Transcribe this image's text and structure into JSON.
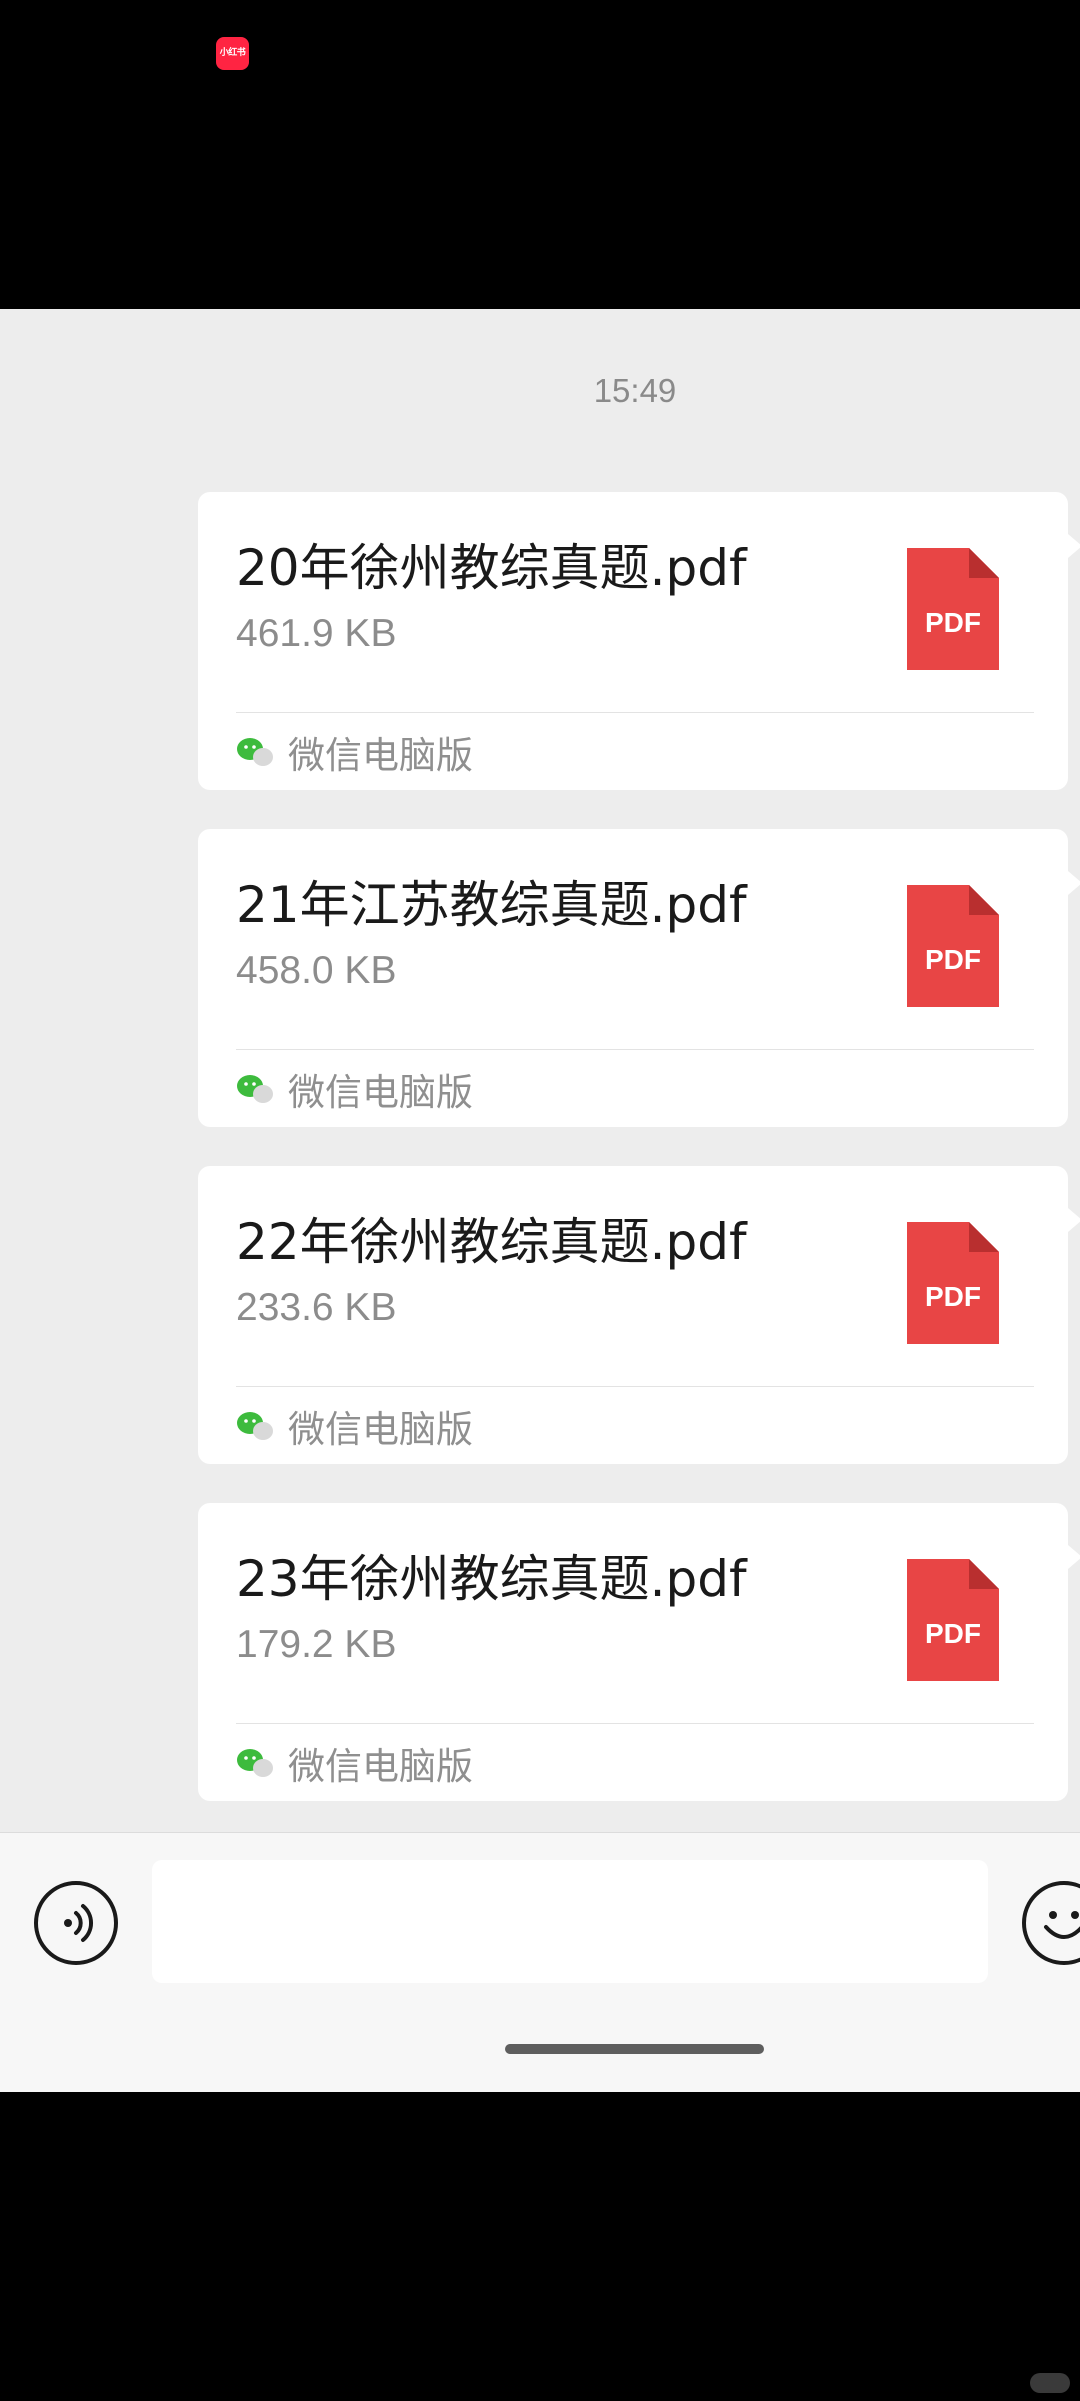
{
  "watermark": {
    "badge_text": "小红书"
  },
  "chat": {
    "timestamp": "15:49",
    "messages": [
      {
        "file_name": "20年徐州教综真题.pdf",
        "file_size": "461.9  KB",
        "file_type_label": "PDF",
        "source": "微信电脑版"
      },
      {
        "file_name": "21年江苏教综真题.pdf",
        "file_size": "458.0  KB",
        "file_type_label": "PDF",
        "source": "微信电脑版"
      },
      {
        "file_name": "22年徐州教综真题.pdf",
        "file_size": "233.6  KB",
        "file_type_label": "PDF",
        "source": "微信电脑版"
      },
      {
        "file_name": "23年徐州教综真题.pdf",
        "file_size": "179.2  KB",
        "file_type_label": "PDF",
        "source": "微信电脑版"
      }
    ]
  },
  "input_bar": {
    "placeholder": ""
  },
  "icons": {
    "file": "pdf-file-icon",
    "source": "wechat-icon",
    "voice": "voice-icon",
    "emoji": "emoji-icon"
  },
  "colors": {
    "chat_background": "#ededed",
    "card_background": "#ffffff",
    "pdf_red": "#e84545",
    "wechat_green": "#3dbb3d"
  }
}
